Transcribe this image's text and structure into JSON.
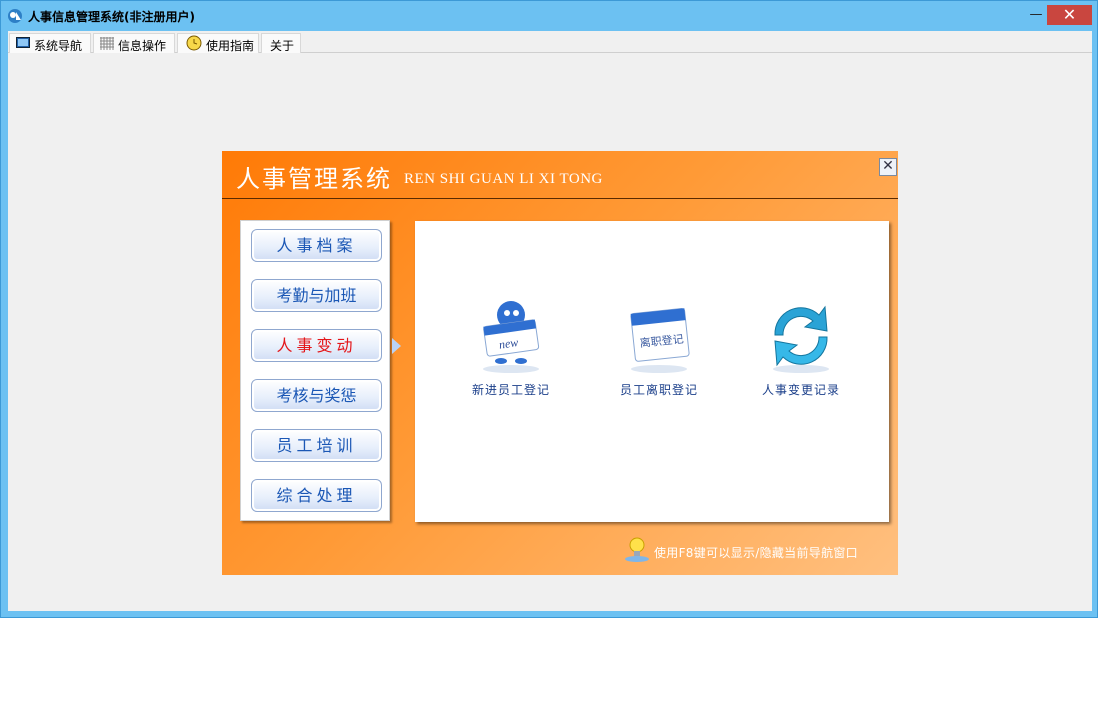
{
  "window": {
    "title": "人事信息管理系统(非注册用户)",
    "minimize": "—",
    "maximize": "❐",
    "close": "✕"
  },
  "tabs": [
    {
      "label": "系统导航",
      "icon": "monitor-icon"
    },
    {
      "label": "信息操作",
      "icon": "grid-icon"
    },
    {
      "label": "使用指南",
      "icon": "clock-icon"
    },
    {
      "label": "关于"
    }
  ],
  "panel": {
    "title_cn": "人事管理系统",
    "title_en": "REN SHI GUAN LI XI TONG",
    "close": "✕",
    "menu": [
      {
        "label": "人事档案",
        "active": false
      },
      {
        "label": "考勤与加班",
        "active": false
      },
      {
        "label": "人事变动",
        "active": true
      },
      {
        "label": "考核与奖惩",
        "active": false
      },
      {
        "label": "员工培训",
        "active": false
      },
      {
        "label": "综合处理",
        "active": false
      }
    ],
    "items": [
      {
        "label": "新进员工登记",
        "icon_text": "new"
      },
      {
        "label": "员工离职登记",
        "icon_text": "离职登记"
      },
      {
        "label": "人事变更记录"
      }
    ],
    "hint": "使用F8键可以显示/隐藏当前导航窗口"
  },
  "colors": {
    "accent_orange": "#ff7a06",
    "menu_text": "#1b57b5",
    "menu_active": "#e4161a",
    "titlebar": "#6cc1f2"
  }
}
